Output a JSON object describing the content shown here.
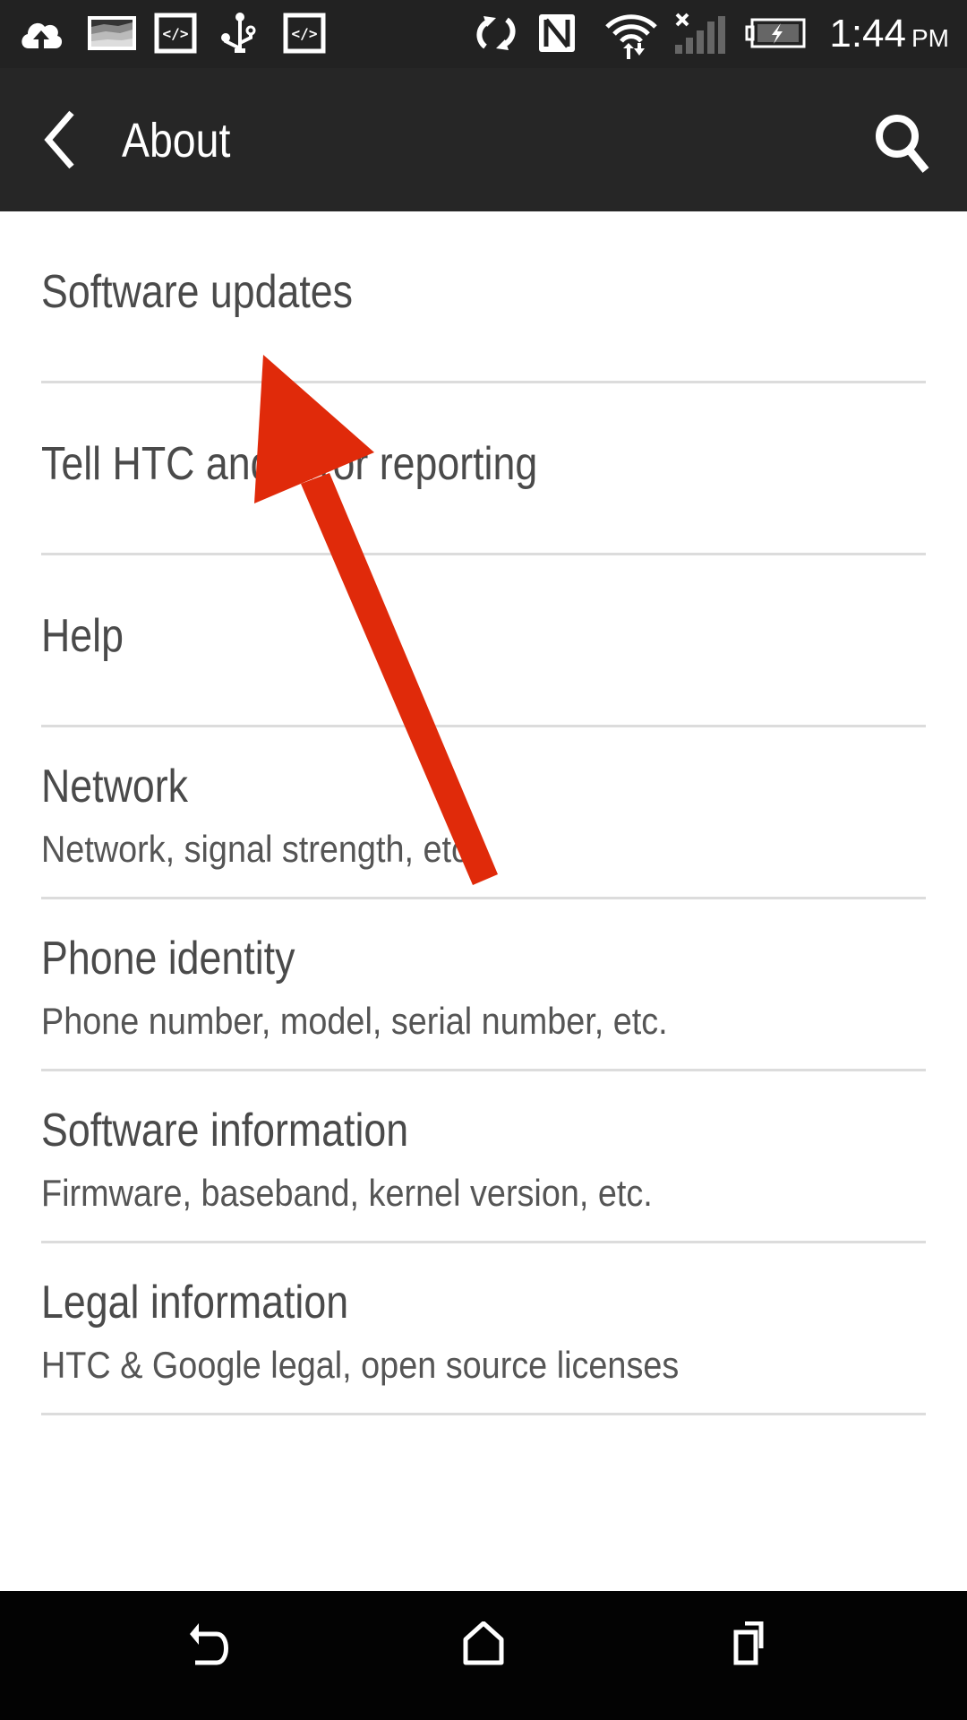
{
  "status_bar": {
    "left_icons": [
      "cloud-upload-icon",
      "gallery-image-icon",
      "code-icon",
      "usb-icon",
      "code-icon"
    ],
    "right_icons": [
      "sync-icon",
      "nfc-icon",
      "wifi-data-icon",
      "no-signal-icon",
      "battery-charging-icon"
    ],
    "time": "1:44",
    "ampm": "PM"
  },
  "app_bar": {
    "title": "About",
    "back_icon": "chevron-left-icon",
    "search_icon": "search-icon"
  },
  "menu_items": [
    {
      "title": "Software updates",
      "subtitle": null
    },
    {
      "title": "Tell HTC and error reporting",
      "subtitle": null
    },
    {
      "title": "Help",
      "subtitle": null
    },
    {
      "title": "Network",
      "subtitle": "Network, signal strength, etc."
    },
    {
      "title": "Phone identity",
      "subtitle": "Phone number, model, serial number, etc."
    },
    {
      "title": "Software information",
      "subtitle": "Firmware, baseband, kernel version, etc."
    },
    {
      "title": "Legal information",
      "subtitle": "HTC & Google legal, open source licenses"
    }
  ],
  "annotation": {
    "type": "arrow",
    "color": "#e02a0a",
    "points_to": "Software updates"
  },
  "nav_bar": {
    "buttons": [
      "back",
      "home",
      "recent-apps"
    ]
  }
}
